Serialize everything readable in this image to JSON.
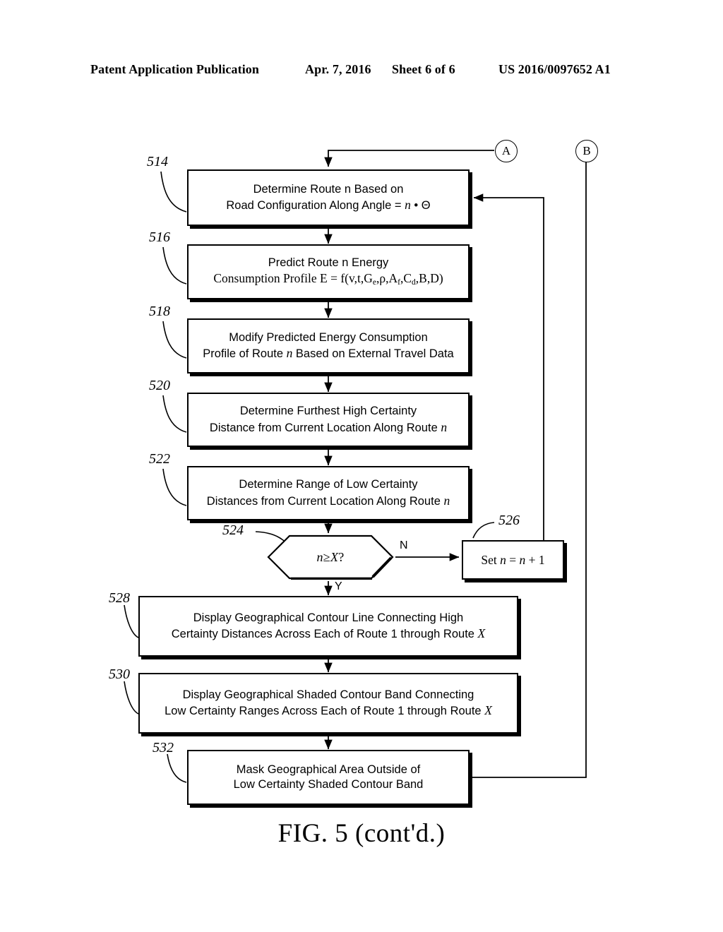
{
  "header": {
    "publication": "Patent Application Publication",
    "date": "Apr. 7, 2016",
    "sheet": "Sheet 6 of 6",
    "number": "US 2016/0097652 A1"
  },
  "figure": {
    "caption": "FIG. 5 (cont'd.)",
    "type": "flowchart"
  },
  "connectors": [
    {
      "id": "conn-a",
      "label": "A"
    },
    {
      "id": "conn-b",
      "label": "B"
    }
  ],
  "branches": {
    "no": "N",
    "yes": "Y"
  },
  "nodes": [
    {
      "ref": "514",
      "shape": "process",
      "line1": "Determine Route n Based on",
      "line2_a": "Road Configuration Along Angle = ",
      "line2_var": "n",
      "line2_b": " • Θ"
    },
    {
      "ref": "516",
      "shape": "process",
      "line1": "Predict Route n Energy",
      "line2_a": "Consumption Profile E = f(v,t,G",
      "line2_sub1": "e",
      "line2_b": ",ρ,A",
      "line2_sub2": "f",
      "line2_c": ",C",
      "line2_sub3": "d",
      "line2_d": ",B,D)"
    },
    {
      "ref": "518",
      "shape": "process",
      "line1": "Modify Predicted Energy Consumption",
      "line2_a": "Profile of Route ",
      "line2_var": "n",
      "line2_b": " Based on External Travel Data"
    },
    {
      "ref": "520",
      "shape": "process",
      "line1": "Determine Furthest High Certainty",
      "line2_a": "Distance from Current Location Along Route ",
      "line2_var": "n",
      "line2_b": ""
    },
    {
      "ref": "522",
      "shape": "process",
      "line1": "Determine Range of Low Certainty",
      "line2_a": "Distances from Current Location Along Route ",
      "line2_var": "n",
      "line2_b": ""
    },
    {
      "ref": "524",
      "shape": "decision",
      "condition_var1": "n",
      "condition_op": " ≥ ",
      "condition_var2": "X",
      "condition_end": "?"
    },
    {
      "ref": "526",
      "shape": "process",
      "line1_a": "Set ",
      "line1_var1": "n",
      "line1_eq": " = ",
      "line1_var2": "n",
      "line1_b": " + 1"
    },
    {
      "ref": "528",
      "shape": "process",
      "line1": "Display Geographical Contour Line Connecting High",
      "line2_a": "Certainty Distances Across Each of Route 1 through Route ",
      "line2_var": "X",
      "line2_b": ""
    },
    {
      "ref": "530",
      "shape": "process",
      "line1": "Display Geographical Shaded Contour Band Connecting",
      "line2_a": "Low Certainty Ranges Across Each of Route 1 through Route ",
      "line2_var": "X",
      "line2_b": ""
    },
    {
      "ref": "532",
      "shape": "process",
      "line1": "Mask Geographical Area Outside of",
      "line2": "Low Certainty Shaded Contour Band"
    }
  ],
  "colors": {
    "ink": "#000000",
    "paper": "#ffffff"
  }
}
